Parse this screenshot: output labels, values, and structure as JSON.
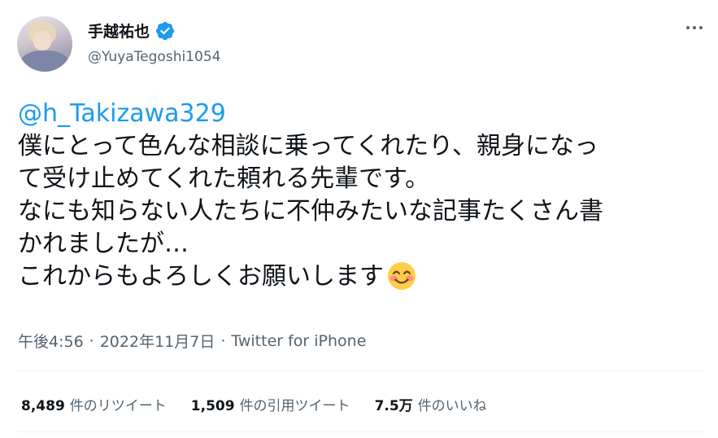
{
  "user": {
    "display_name": "手越祐也",
    "handle": "@YuyaTegoshi1054",
    "verified": true
  },
  "tweet": {
    "mention": "@h_Takizawa329",
    "lines": [
      "僕にとって色んな相談に乗ってくれたり、親身になっ",
      "て受け止めてくれた頼れる先輩です。",
      "なにも知らない人たちに不仲みたいな記事たくさん書",
      "かれましたが…",
      "これからもよろしくお願いします"
    ],
    "emoji": "smiling-face-with-blushing-cheeks"
  },
  "meta": {
    "time": "午後4:56",
    "separator": "·",
    "date": "2022年11月7日",
    "source": "Twitter for iPhone"
  },
  "stats": {
    "retweets_count": "8,489",
    "retweets_label": "件のリツイート",
    "quotes_count": "1,509",
    "quotes_label": "件の引用ツイート",
    "likes_count": "7.5万",
    "likes_label": "件のいいね"
  },
  "colors": {
    "link": "#1d9bf0",
    "text": "#0f1419",
    "secondary": "#536471",
    "divider": "#eff3f4"
  }
}
